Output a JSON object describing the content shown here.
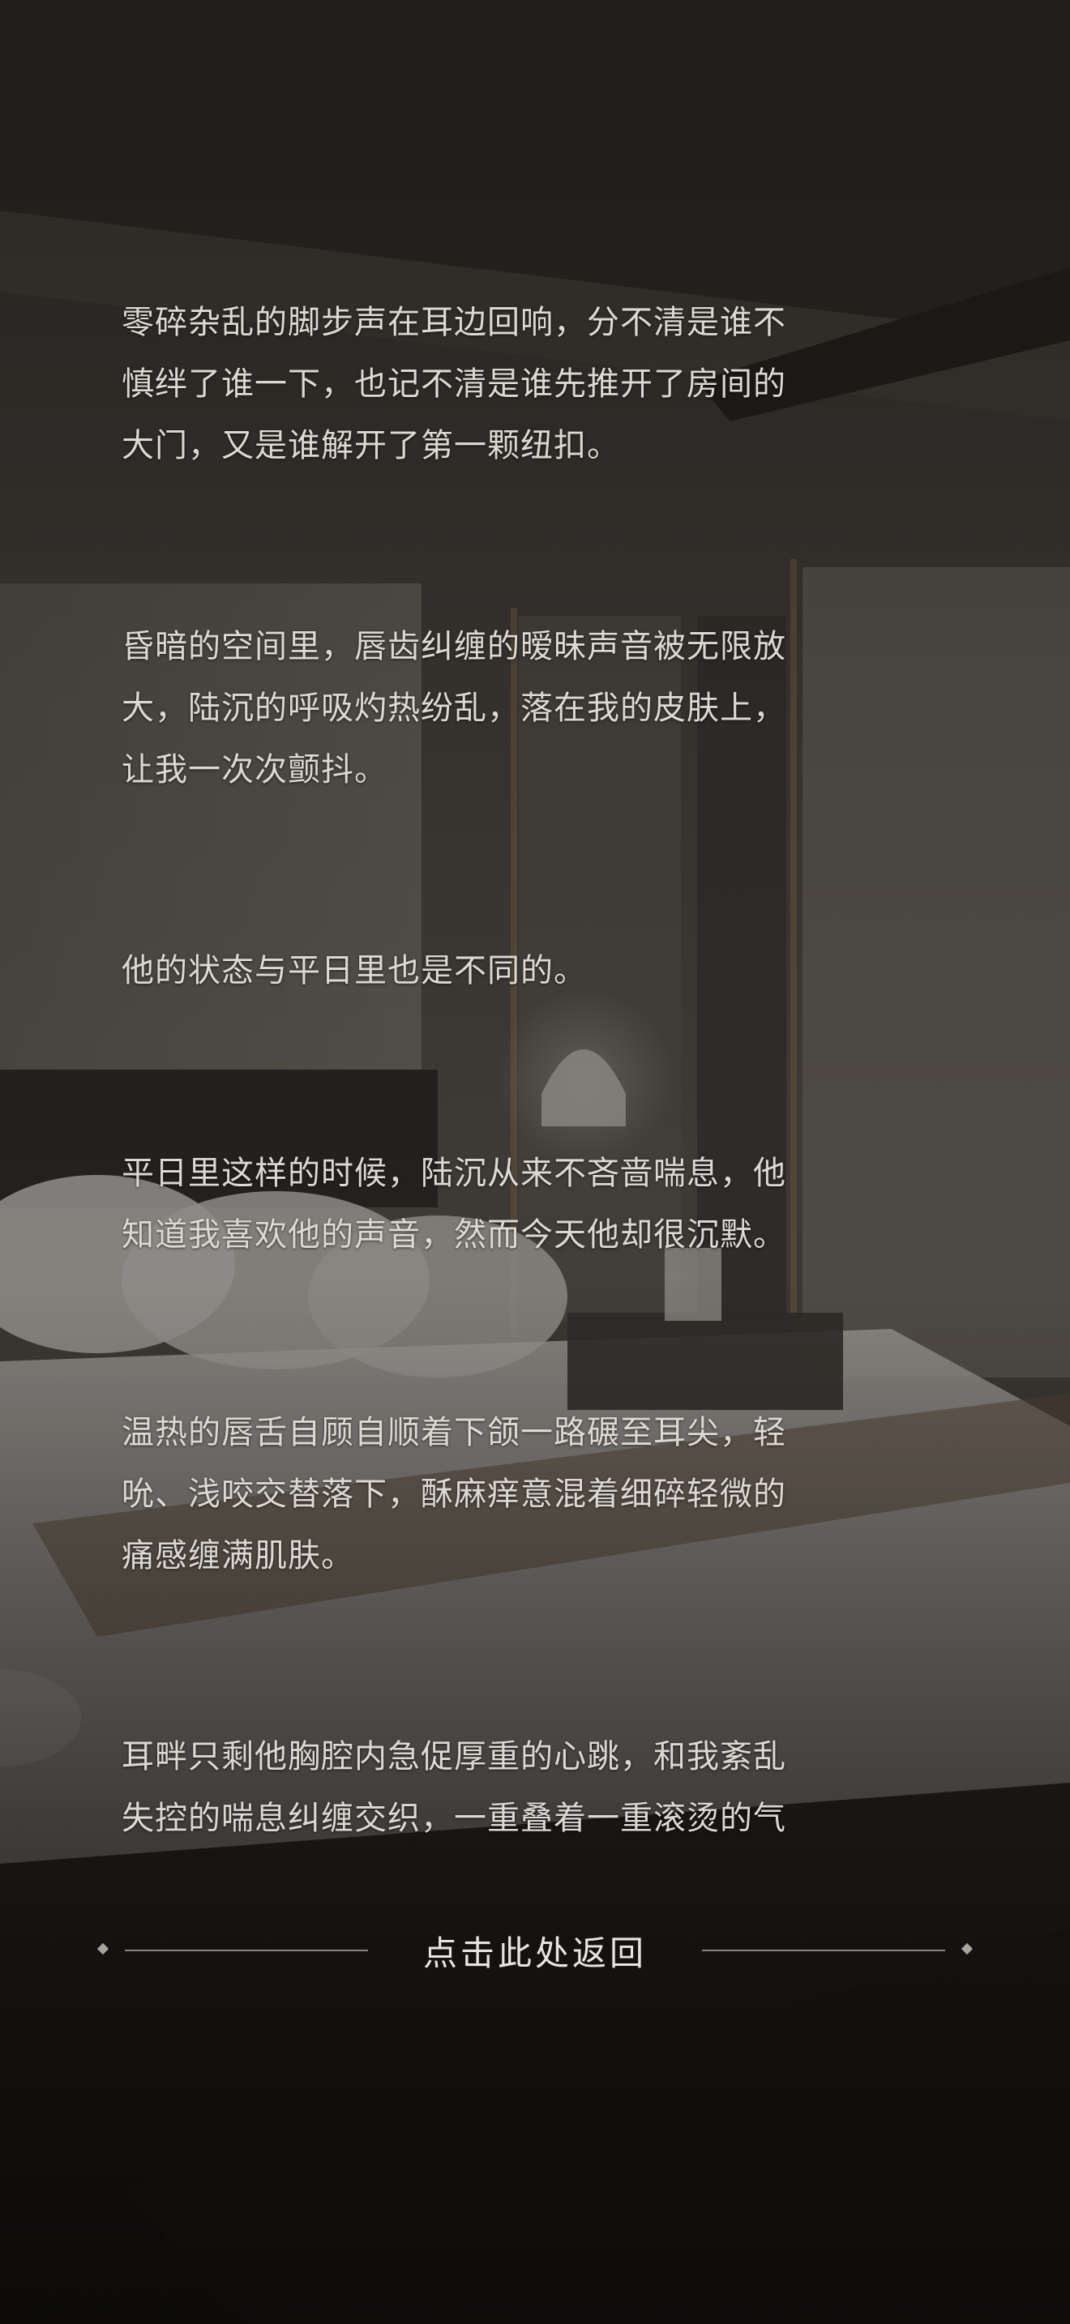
{
  "story": {
    "paragraphs": [
      "零碎杂乱的脚步声在耳边回响，分不清是谁不\n慎绊了谁一下，也记不清是谁先推开了房间的\n大门，又是谁解开了第一颗纽扣。",
      "昏暗的空间里，唇齿纠缠的暧昧声音被无限放\n大，陆沉的呼吸灼热纷乱，落在我的皮肤上，\n让我一次次颤抖。",
      "他的状态与平日里也是不同的。",
      "平日里这样的时候，陆沉从来不吝啬喘息，他\n知道我喜欢他的声音，然而今天他却很沉默。",
      "温热的唇舌自顾自顺着下颌一路碾至耳尖，轻\n吮、浅咬交替落下，酥麻痒意混着细碎轻微的\n痛感缠满肌肤。",
      "耳畔只剩他胸腔内急促厚重的心跳，和我紊乱\n失控的喘息纠缠交织，一重叠着一重滚烫的气"
    ]
  },
  "return_bar": {
    "label": "点击此处返回"
  },
  "colors": {
    "text": "#dcd9d3",
    "divider": "#8a8580",
    "background": "#1a1816"
  }
}
